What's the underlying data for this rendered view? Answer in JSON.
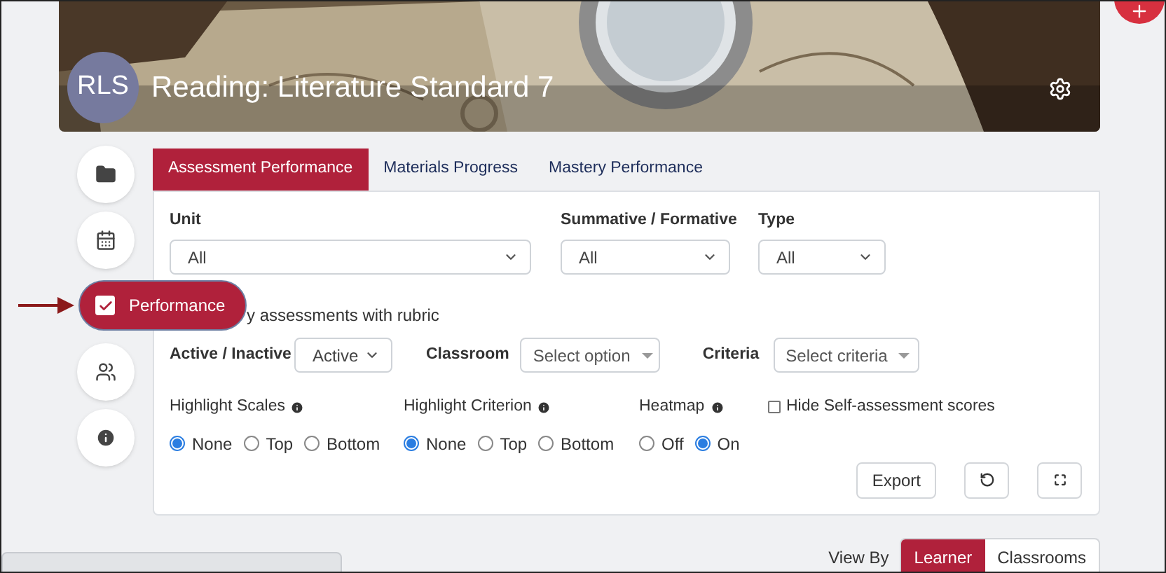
{
  "header": {
    "avatar": "RLS",
    "title": "Reading: Literature Standard 7"
  },
  "sidebar": {
    "items": [
      {
        "kind": "folder",
        "selected": false
      },
      {
        "kind": "calendar",
        "selected": false
      },
      {
        "kind": "check",
        "label": "Performance",
        "selected": true
      },
      {
        "kind": "people",
        "selected": false
      },
      {
        "kind": "info",
        "selected": false
      }
    ]
  },
  "tabs": [
    {
      "label": "Assessment Performance",
      "selected": true
    },
    {
      "label": "Materials Progress",
      "selected": false
    },
    {
      "label": "Mastery Performance",
      "selected": false
    }
  ],
  "filters": [
    {
      "label": "Unit",
      "value": "All"
    },
    {
      "label": "Summative / Formative",
      "value": "All"
    },
    {
      "label": "Type",
      "value": "All"
    }
  ],
  "rubric_option": {
    "label": "y assessments with rubric"
  },
  "filters2": [
    {
      "label": "Active / Inactive",
      "value": "Active",
      "kind": "native"
    },
    {
      "label": "Classroom",
      "placeholder": "Select option",
      "kind": "search"
    },
    {
      "label": "Criteria",
      "placeholder": "Select criteria",
      "kind": "search"
    }
  ],
  "radio_groups": [
    {
      "label": "Highlight Scales",
      "options": [
        {
          "label": "None",
          "selected": true
        },
        {
          "label": "Top",
          "selected": false
        },
        {
          "label": "Bottom",
          "selected": false
        }
      ]
    },
    {
      "label": "Highlight Criterion",
      "options": [
        {
          "label": "None",
          "selected": true
        },
        {
          "label": "Top",
          "selected": false
        },
        {
          "label": "Bottom",
          "selected": false
        }
      ]
    },
    {
      "label": "Heatmap",
      "options": [
        {
          "label": "Off",
          "selected": false
        },
        {
          "label": "On",
          "selected": true
        }
      ]
    }
  ],
  "hide_self_assessment": {
    "label": "Hide Self-assessment scores",
    "checked": false
  },
  "export_button": "Export",
  "view_by": {
    "label": "View By",
    "options": [
      {
        "label": "Learner",
        "selected": true
      },
      {
        "label": "Classrooms",
        "selected": false
      }
    ]
  }
}
